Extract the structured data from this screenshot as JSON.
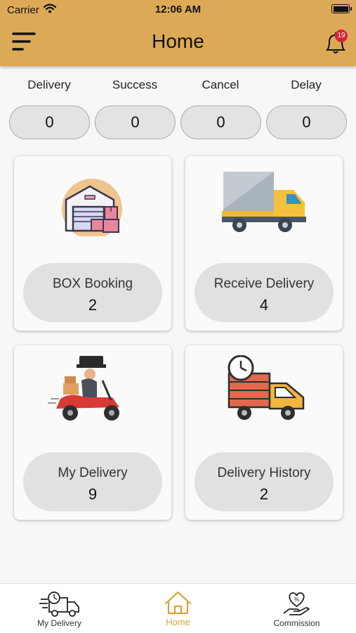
{
  "status_bar": {
    "carrier": "Carrier",
    "time": "12:06 AM"
  },
  "header": {
    "title": "Home",
    "notification_count": "19"
  },
  "stats": [
    {
      "label": "Delivery",
      "value": "0"
    },
    {
      "label": "Success",
      "value": "0"
    },
    {
      "label": "Cancel",
      "value": "0"
    },
    {
      "label": "Delay",
      "value": "0"
    }
  ],
  "cards": [
    {
      "label": "BOX Booking",
      "count": "2",
      "icon": "warehouse-icon"
    },
    {
      "label": "Receive Delivery",
      "count": "4",
      "icon": "truck-icon"
    },
    {
      "label": "My Delivery",
      "count": "9",
      "icon": "scooter-courier-icon"
    },
    {
      "label": "Delivery History",
      "count": "2",
      "icon": "delivery-history-truck-icon"
    }
  ],
  "tabs": [
    {
      "label": "My Delivery",
      "icon": "delivery-truck-clock-icon",
      "active": false
    },
    {
      "label": "Home",
      "icon": "home-icon",
      "active": true
    },
    {
      "label": "Commission",
      "icon": "commission-hand-heart-icon",
      "active": false
    }
  ],
  "colors": {
    "header": "#dcaa57",
    "accent": "#d9a23d",
    "badge": "#d9233a",
    "pill": "#e1e1e1"
  }
}
